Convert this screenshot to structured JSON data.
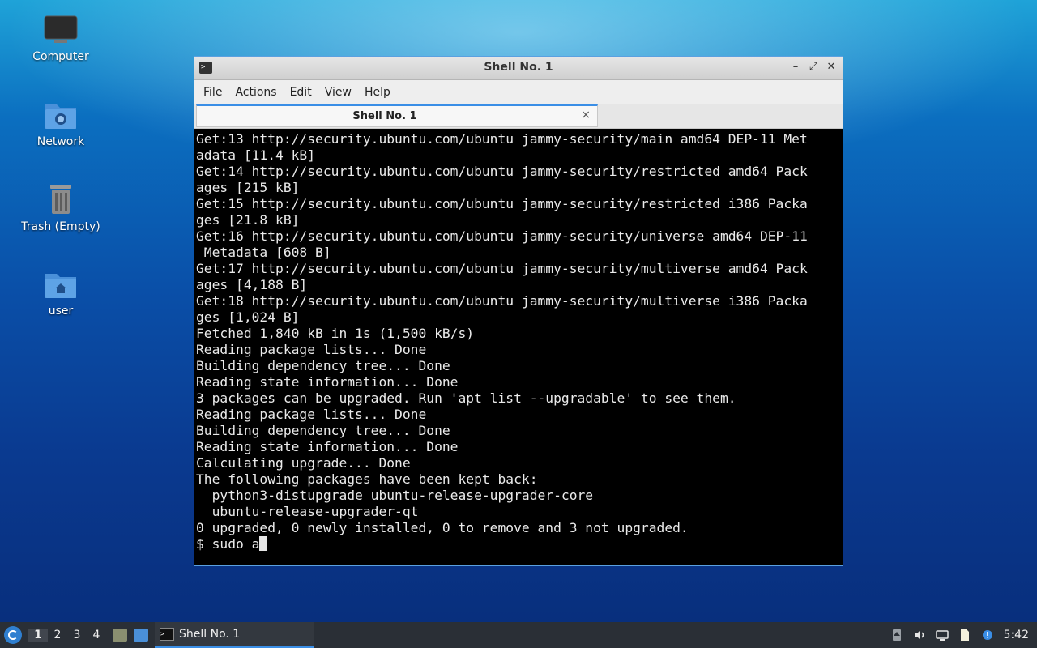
{
  "desktop": {
    "icons": [
      {
        "label": "Computer",
        "icon": "monitor-icon"
      },
      {
        "label": "Network",
        "icon": "network-folder-icon"
      },
      {
        "label": "Trash (Empty)",
        "icon": "trash-icon"
      },
      {
        "label": "user",
        "icon": "home-folder-icon"
      }
    ]
  },
  "window": {
    "title": "Shell No. 1",
    "menu": [
      "File",
      "Actions",
      "Edit",
      "View",
      "Help"
    ],
    "tab_label": "Shell No. 1",
    "tab_close": "×",
    "controls": [
      "–",
      "⤢",
      "✕"
    ]
  },
  "console": {
    "lines": [
      "Get:13 http://security.ubuntu.com/ubuntu jammy-security/main amd64 DEP-11 Met",
      "adata [11.4 kB]",
      "Get:14 http://security.ubuntu.com/ubuntu jammy-security/restricted amd64 Pack",
      "ages [215 kB]",
      "Get:15 http://security.ubuntu.com/ubuntu jammy-security/restricted i386 Packa",
      "ges [21.8 kB]",
      "Get:16 http://security.ubuntu.com/ubuntu jammy-security/universe amd64 DEP-11",
      " Metadata [608 B]",
      "Get:17 http://security.ubuntu.com/ubuntu jammy-security/multiverse amd64 Pack",
      "ages [4,188 B]",
      "Get:18 http://security.ubuntu.com/ubuntu jammy-security/multiverse i386 Packa",
      "ges [1,024 B]",
      "Fetched 1,840 kB in 1s (1,500 kB/s)",
      "Reading package lists... Done",
      "Building dependency tree... Done",
      "Reading state information... Done",
      "3 packages can be upgraded. Run 'apt list --upgradable' to see them.",
      "Reading package lists... Done",
      "Building dependency tree... Done",
      "Reading state information... Done",
      "Calculating upgrade... Done",
      "The following packages have been kept back:",
      "  python3-distupgrade ubuntu-release-upgrader-core",
      "  ubuntu-release-upgrader-qt",
      "0 upgraded, 0 newly installed, 0 to remove and 3 not upgraded."
    ],
    "prompt": "$ sudo a"
  },
  "taskbar": {
    "workspaces": [
      "1",
      "2",
      "3",
      "4"
    ],
    "active_workspace": "1",
    "task_label": "Shell No. 1",
    "clock": "5:42"
  },
  "colors": {
    "accent": "#3a8ee6",
    "terminal_bg": "#000000",
    "terminal_fg": "#eaeaea",
    "taskbar_bg": "#2a2f36"
  }
}
